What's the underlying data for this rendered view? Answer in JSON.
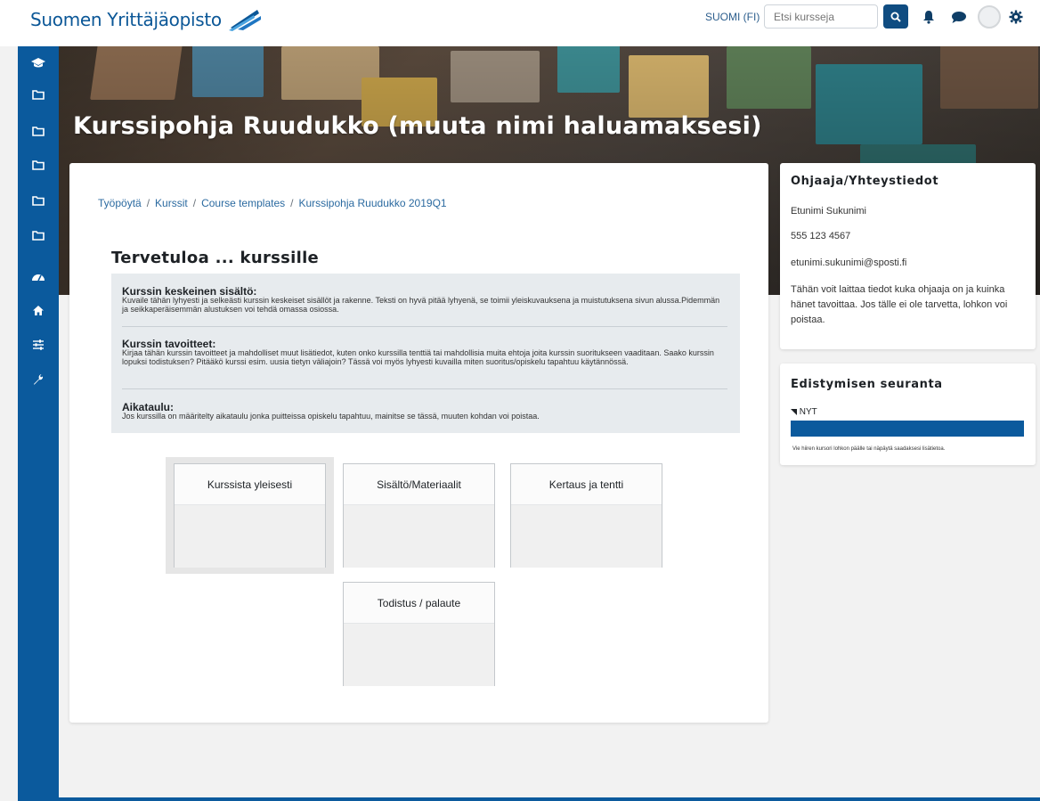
{
  "brand": {
    "name": "Suomen Yrittäjäopisto"
  },
  "navbar": {
    "language": "SUOMI (FI)",
    "search_placeholder": "Etsi kursseja",
    "icons": [
      "search-icon",
      "bell-icon",
      "chat-icon",
      "avatar",
      "gear-icon"
    ]
  },
  "dock": {
    "items": [
      "graduation-cap-icon",
      "folder-icon",
      "folder-icon",
      "folder-icon",
      "folder-icon",
      "folder-icon",
      "dashboard-icon",
      "home-icon",
      "sliders-icon",
      "wrench-icon"
    ]
  },
  "header": {
    "title": "Kurssipohja Ruudukko (muuta nimi haluamaksesi)"
  },
  "breadcrumb": [
    "Työpöytä",
    "Kurssit",
    "Course templates",
    "Kurssipohja Ruudukko 2019Q1"
  ],
  "breadcrumb_separator": "/",
  "main": {
    "welcome": "Tervetuloa ... kurssille",
    "sections": [
      {
        "heading": "Kurssin keskeinen sisältö:",
        "text": "Kuvaile tähän lyhyesti ja selkeästi kurssin keskeiset sisällöt ja rakenne. Teksti on hyvä pitää lyhyenä, se toimii yleiskuvauksena ja muistutuksena sivun alussa.Pidemmän ja seikkaperäisemmän alustuksen voi tehdä omassa osiossa."
      },
      {
        "heading": "Kurssin tavoitteet:",
        "text": "Kirjaa tähän kurssin tavoitteet ja mahdolliset muut lisätiedot, kuten onko kurssilla tenttiä tai mahdollisia muita ehtoja joita kurssin suoritukseen vaaditaan. Saako kurssin lopuksi todistuksen? Pitääkö kurssi esim. uusia tietyn väliajoin? Tässä voi myös lyhyesti kuvailla miten suoritus/opiskelu tapahtuu käytännössä."
      },
      {
        "heading": "Aikataulu:",
        "text": "Jos kurssilla on määritelty aikataulu jonka puitteissa opiskelu tapahtuu, mainitse se tässä, muuten kohdan voi poistaa."
      }
    ],
    "tiles": [
      "Kurssista yleisesti",
      "Sisältö/Materiaalit",
      "Kertaus ja tentti",
      "Todistus / palaute"
    ]
  },
  "sidebar": {
    "contact": {
      "title": "Ohjaaja/Yhteystiedot",
      "name": "Etunimi Sukunimi",
      "phone": "555 123 4567",
      "email": "etunimi.sukunimi@sposti.fi",
      "note": "Tähän voit laittaa tiedot kuka ohjaaja on ja kuinka hänet tavoittaa. Jos tälle ei ole tarvetta, lohkon voi poistaa."
    },
    "progress": {
      "title": "Edistymisen seuranta",
      "now_label": "NYT",
      "note": "Vie hiiren kursori lohkon päälle tai näpäytä saadaksesi lisätietoa."
    }
  },
  "colors": {
    "primary": "#0b5a9d",
    "brand_text": "#0b5797",
    "link": "#2b6aa0"
  }
}
